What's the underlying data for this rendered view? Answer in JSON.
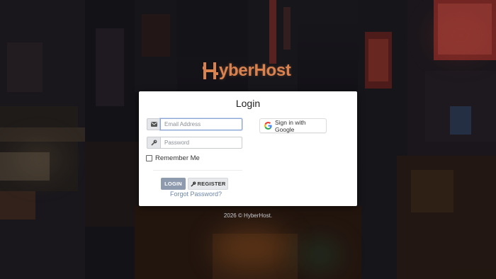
{
  "brand": {
    "name": "HyberHost",
    "logo_letters": "yberHost",
    "accent": "#d9824f"
  },
  "login": {
    "title": "Login",
    "email_placeholder": "Email Address",
    "password_placeholder": "Password",
    "remember_label": "Remember Me",
    "login_button": "LOGIN",
    "register_button": "REGISTER",
    "forgot_link": "Forgot Password?",
    "google_button": "Sign in with Google",
    "icons": {
      "email": "envelope-icon",
      "password": "key-icon",
      "register": "key-icon",
      "google": "google-icon"
    }
  },
  "footer": {
    "text": "2026 © HyberHost."
  }
}
